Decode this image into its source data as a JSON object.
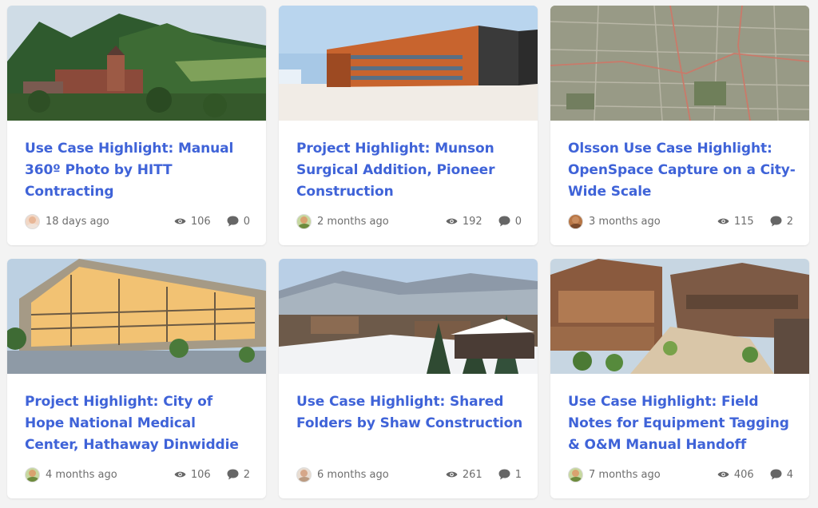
{
  "cards": [
    {
      "title": "Use Case Highlight: Manual 360º Photo by HITT Contracting",
      "age": "18 days ago",
      "views": "106",
      "comments": "0",
      "avatar": {
        "bg": "#f1d7c6",
        "skin": "#e8b797",
        "shirt": "#efe3da"
      }
    },
    {
      "title": "Project Highlight: Munson Surgical Addition, Pioneer Construction",
      "age": "2 months ago",
      "views": "192",
      "comments": "0",
      "avatar": {
        "bg": "#c7d8a0",
        "skin": "#d9a26f",
        "shirt": "#6d8b3d"
      }
    },
    {
      "title": "Olsson Use Case Highlight: OpenSpace Capture on a City-Wide Scale",
      "age": "3 months ago",
      "views": "115",
      "comments": "2",
      "avatar": {
        "bg": "#b77646",
        "skin": "#c98c5e",
        "shirt": "#7a4a2c"
      }
    },
    {
      "title": "Project Highlight: City of Hope National Medical Center, Hathaway Dinwiddie",
      "age": "4 months ago",
      "views": "106",
      "comments": "2",
      "avatar": {
        "bg": "#c7d8a0",
        "skin": "#d9a26f",
        "shirt": "#6d8b3d"
      }
    },
    {
      "title": "Use Case Highlight: Shared Folders by Shaw Construction",
      "age": "6 months ago",
      "views": "261",
      "comments": "1",
      "avatar": {
        "bg": "#e9ddd2",
        "skin": "#d6a789",
        "shirt": "#bb9b81"
      }
    },
    {
      "title": "Use Case Highlight: Field Notes for Equipment Tagging & O&M Manual Handoff",
      "age": "7 months ago",
      "views": "406",
      "comments": "4",
      "avatar": {
        "bg": "#c7d8a0",
        "skin": "#d9a26f",
        "shirt": "#6d8b3d"
      }
    }
  ],
  "icons": {
    "views": "eye-icon",
    "comments": "speech-bubble-icon"
  },
  "colors": {
    "title": "#3f63d8",
    "meta": "#6d6d6d",
    "background": "#f3f3f3",
    "card": "#ffffff"
  }
}
